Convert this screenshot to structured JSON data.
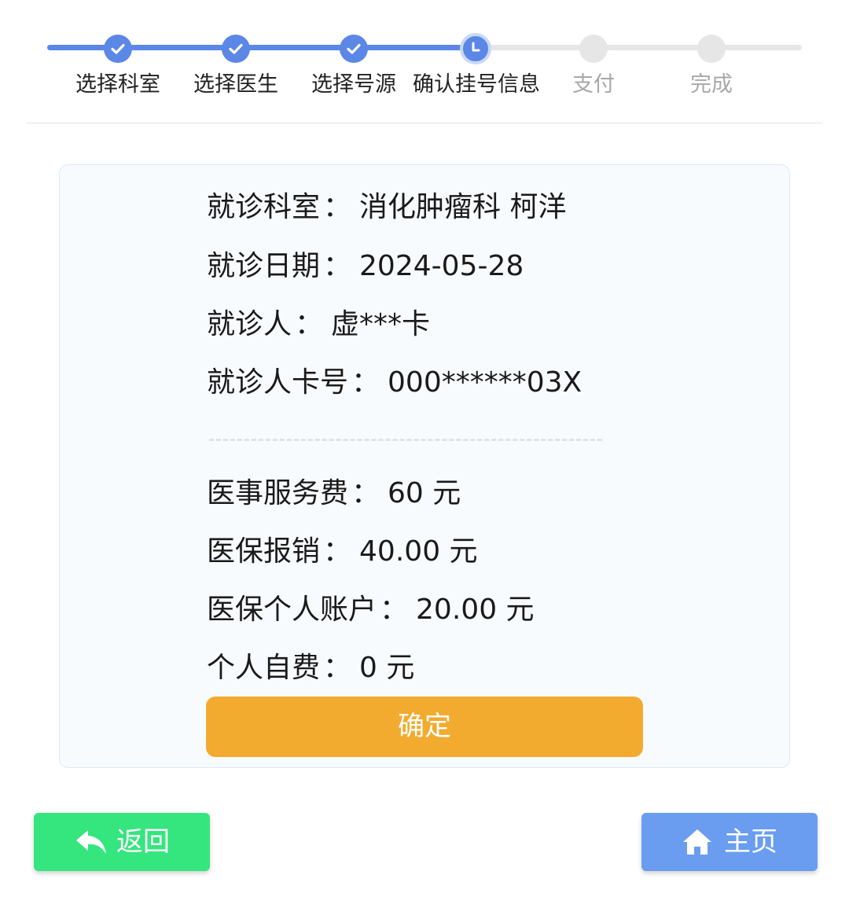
{
  "stepper": {
    "steps": [
      {
        "label": "选择科室",
        "state": "done"
      },
      {
        "label": "选择医生",
        "state": "done"
      },
      {
        "label": "选择号源",
        "state": "done"
      },
      {
        "label": "确认挂号信息",
        "state": "current"
      },
      {
        "label": "支付",
        "state": "pending"
      },
      {
        "label": "完成",
        "state": "pending"
      }
    ]
  },
  "info": {
    "department_label": "就诊科室",
    "department_value": "消化肿瘤科 柯洋",
    "date_label": "就诊日期",
    "date_value": "2024-05-28",
    "patient_label": "就诊人",
    "patient_value": "虚***卡",
    "card_label": "就诊人卡号",
    "card_value": "000******03X",
    "fee_label": "医事服务费",
    "fee_value": "60 元",
    "insurance_label": "医保报销",
    "insurance_value": "40.00 元",
    "account_label": "医保个人账户",
    "account_value": "20.00 元",
    "self_pay_label": "个人自费",
    "self_pay_value": "0 元",
    "colon": "："
  },
  "actions": {
    "confirm_label": "确定",
    "back_label": "返回",
    "home_label": "主页"
  },
  "colors": {
    "primary_blue": "#5b87e6",
    "confirm_orange": "#f2ab2f",
    "back_green": "#35e57e",
    "home_blue": "#6a9df0"
  },
  "icons": {
    "done_step": "check-icon",
    "current_step": "clock-icon",
    "back": "reply-arrow-icon",
    "home": "home-icon"
  }
}
